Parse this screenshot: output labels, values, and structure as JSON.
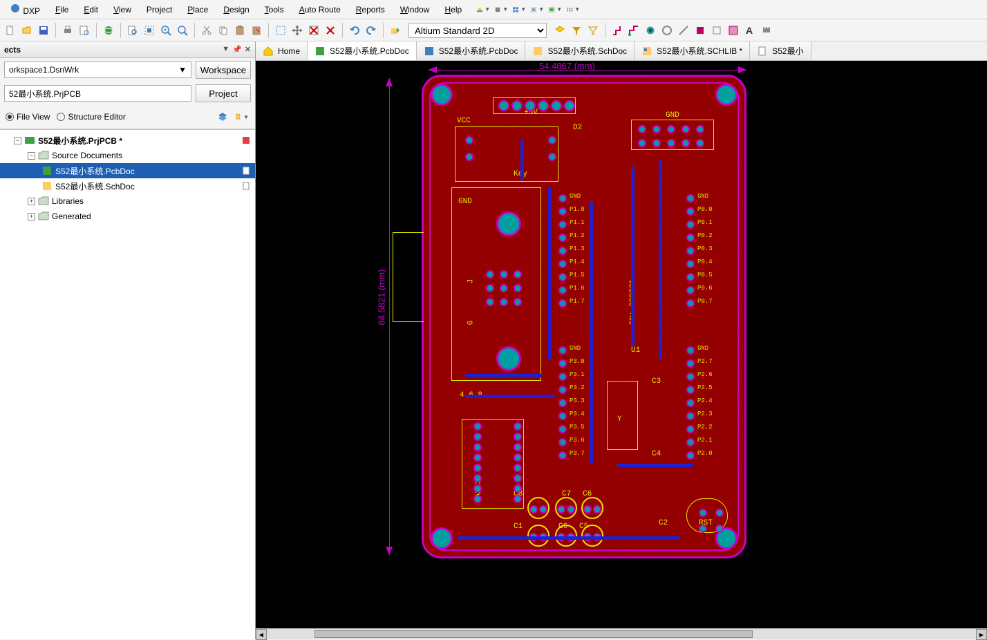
{
  "menu": {
    "dxp": "DXP",
    "file": "File",
    "edit": "Edit",
    "view": "View",
    "project": "Project",
    "place": "Place",
    "design": "Design",
    "tools": "Tools",
    "autoroute": "Auto Route",
    "reports": "Reports",
    "window": "Window",
    "help": "Help"
  },
  "toolbar": {
    "viewmode": "Altium Standard 2D"
  },
  "panel": {
    "title": "ects",
    "workspace": "orkspace1.DsnWrk",
    "workspace_btn": "Workspace",
    "project": "52最小系统.PrjPCB",
    "project_btn": "Project",
    "fileview": "File View",
    "structeditor": "Structure Editor"
  },
  "tree": {
    "root": "S52最小系统.PrjPCB *",
    "source_docs": "Source Documents",
    "pcbdoc": "S52最小系统.PcbDoc",
    "schdoc": "S52最小系统.SchDoc",
    "libraries": "Libraries",
    "generated": "Generated"
  },
  "tabs": {
    "home": "Home",
    "pcb1": "S52最小系统.PcbDoc",
    "pcb2": "S52最小系统.PcbDoc",
    "sch": "S52最小系统.SchDoc",
    "schlib": "S52最小系统.SCHLIB *",
    "extra": "S52最小"
  },
  "dims": {
    "width": "54.4867 (mm)",
    "height": "84.5821 (mm)"
  },
  "silk": {
    "vcc": "VCC",
    "v5": "+5V",
    "gnd": "GND",
    "d2": "D2",
    "key": "Key",
    "sn": "SN: 090921",
    "u1": "U1",
    "y": "Y",
    "c3": "C3",
    "c4": "C4",
    "max232": "MAX232",
    "rst": "RST",
    "c1": "C1",
    "c2": "C2",
    "c5": "C5",
    "c6": "C6",
    "c7": "C7",
    "c8": "C8",
    "j": "J",
    "g": "G",
    "nums468": "4 6  8",
    "p1": [
      "GND",
      "P1.0",
      "P1.1",
      "P1.2",
      "P1.3",
      "P1.4",
      "P1.5",
      "P1.6",
      "P1.7"
    ],
    "p0": [
      "GND",
      "P0.0",
      "P0.1",
      "P0.2",
      "P0.3",
      "P0.4",
      "P0.5",
      "P0.6",
      "P0.7"
    ],
    "p3": [
      "GND",
      "P3.0",
      "P3.1",
      "P3.2",
      "P3.3",
      "P3.4",
      "P3.5",
      "P3.6",
      "P3.7"
    ],
    "p2": [
      "GND",
      "P2.7",
      "P2.6",
      "P2.5",
      "P2.4",
      "P2.3",
      "P2.2",
      "P2.1",
      "P2.0"
    ]
  }
}
